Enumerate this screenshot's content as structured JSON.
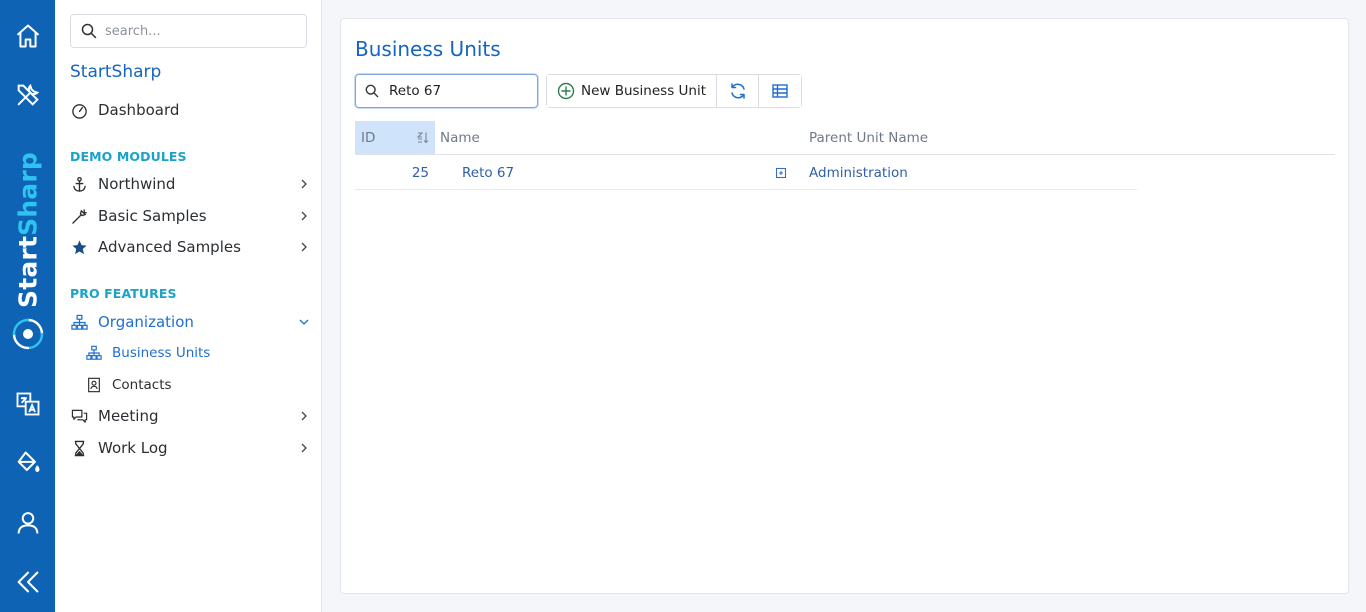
{
  "rail": {
    "brand_start": "Start",
    "brand_sharp": "Sharp",
    "icons": [
      "home-icon",
      "tools-icon",
      "translate-icon",
      "paint-bucket-icon",
      "user-icon",
      "collapse-icon"
    ]
  },
  "sidebar": {
    "search_placeholder": "search...",
    "brand": "StartSharp",
    "dashboard": "Dashboard",
    "section_demo": "DEMO MODULES",
    "northwind": "Northwind",
    "basic_samples": "Basic Samples",
    "advanced_samples": "Advanced Samples",
    "section_pro": "PRO FEATURES",
    "organization": "Organization",
    "business_units": "Business Units",
    "contacts": "Contacts",
    "meeting": "Meeting",
    "work_log": "Work Log"
  },
  "main": {
    "title": "Business Units",
    "search_value": "Reto 67",
    "new_button": "New Business Unit",
    "columns": {
      "id": "ID",
      "name": "Name",
      "parent": "Parent Unit Name"
    },
    "rows": [
      {
        "id": "25",
        "name": "Reto 67",
        "parent": "Administration"
      }
    ]
  },
  "colors": {
    "rail": "#0e63b4",
    "accent": "#1565c0",
    "section": "#1aa3c9",
    "link": "#2f5fa8",
    "sorted_header": "#cfe3fb"
  }
}
